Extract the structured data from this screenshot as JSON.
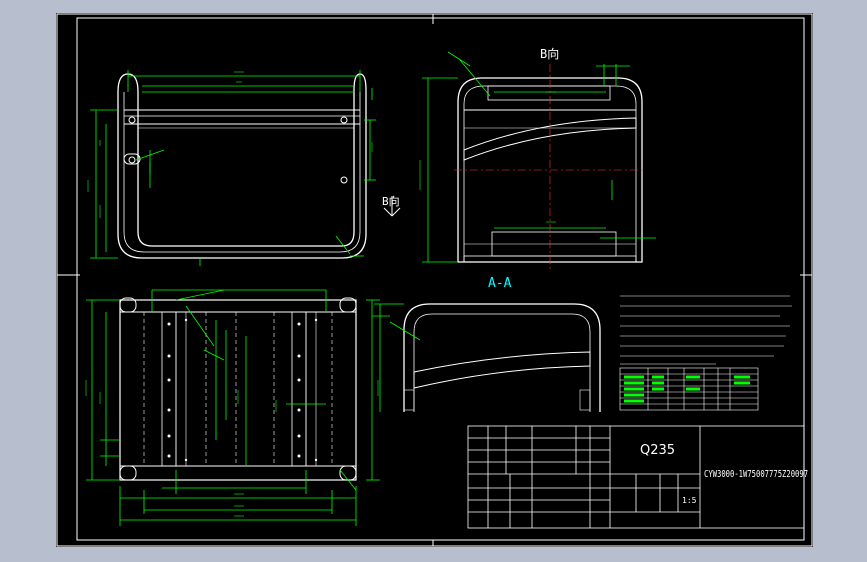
{
  "views": {
    "side_view_label": "B向",
    "front_view_arrow_label": "B向",
    "section_label": "A-A"
  },
  "title_block": {
    "material": "Q235",
    "scale": "1:5",
    "drawing_number": "CYW3000-1W75007775Z20097"
  },
  "colors": {
    "background": "#000000",
    "geometry": "#ffffff",
    "dimensions": "#00ff00",
    "center_lines": "#ff3333",
    "section_label": "#00ffff",
    "viewer_chrome": "#b7bfce"
  }
}
